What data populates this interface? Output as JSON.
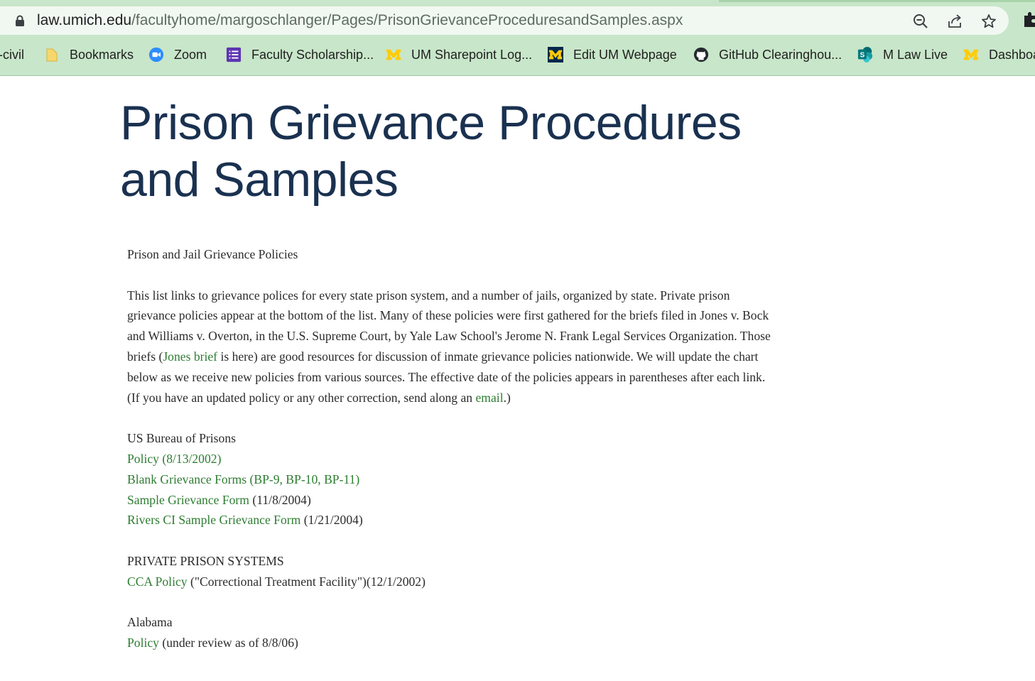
{
  "browser": {
    "url_host": "law.umich.edu",
    "url_path": "/facultyhome/margoschlanger/Pages/PrisonGrievanceProceduresandSamples.aspx",
    "icons": [
      "lock-icon",
      "zoom-out-icon",
      "share-icon",
      "star-icon",
      "extensions-icon"
    ],
    "bookmarks": [
      {
        "label": "-civil"
      },
      {
        "label": "Bookmarks",
        "icon": "folder-icon"
      },
      {
        "label": "Zoom",
        "icon": "zoom-app-icon"
      },
      {
        "label": "Faculty Scholarship...",
        "icon": "list-app-icon"
      },
      {
        "label": "UM Sharepoint Log...",
        "icon": "um-block-m-icon"
      },
      {
        "label": "Edit UM Webpage",
        "icon": "um-block-m-dark-icon"
      },
      {
        "label": "GitHub Clearinghou...",
        "icon": "github-icon"
      },
      {
        "label": "M Law Live",
        "icon": "sharepoint-icon"
      },
      {
        "label": "Dashboa",
        "icon": "um-block-m-icon"
      }
    ],
    "colors": {
      "chrome": "#c8e6c9",
      "omnibox": "#f1f8f1"
    }
  },
  "page": {
    "title": "Prison Grievance Procedures and Samples",
    "heading": "Prison and Jail Grievance Policies",
    "intro": {
      "part1": "This list links to grievance polices for every state prison system, and a number of jails, organized by state.  Private prison grievance policies appear at the bottom of the list. Many of these policies were first gathered for the briefs filed in Jones v. Bock and Williams v. Overton, in the U.S. Supreme Court, by Yale Law School's Jerome N. Frank Legal Services Organization.  Those briefs (",
      "link1": "Jones brief",
      "part2": " is here) are good resources for discussion of inmate grievance policies nationwide.  We will update the chart below as we receive new policies from various sources.  The effective date of the policies appears in parentheses after each link.  (If you have an updated policy or any other correction, send along an ",
      "link2": "email",
      "part3": ".)"
    },
    "bop": {
      "heading": "US Bureau of Prisons",
      "items": [
        {
          "link": "Policy (8/13/2002)",
          "suffix": ""
        },
        {
          "link": "Blank Grievance Forms (BP-9, BP-10, BP-11)",
          "suffix": ""
        },
        {
          "link": "Sample Grievance Form",
          "suffix": " (11/8/2004)"
        },
        {
          "link": "Rivers CI Sample Grievance Form",
          "suffix": " (1/21/2004)"
        }
      ]
    },
    "private": {
      "heading": "PRIVATE PRISON SYSTEMS",
      "items": [
        {
          "link": "CCA Policy",
          "suffix": " (\"Correctional Treatment Facility\")(12/1/2002)"
        }
      ]
    },
    "alabama": {
      "heading": "Alabama",
      "items": [
        {
          "link": "Policy",
          "suffix": " (under review as of 8/8/06)"
        }
      ]
    },
    "colors": {
      "title": "#1a3150",
      "link": "#2e7d32",
      "text": "#2b2b2b"
    }
  }
}
